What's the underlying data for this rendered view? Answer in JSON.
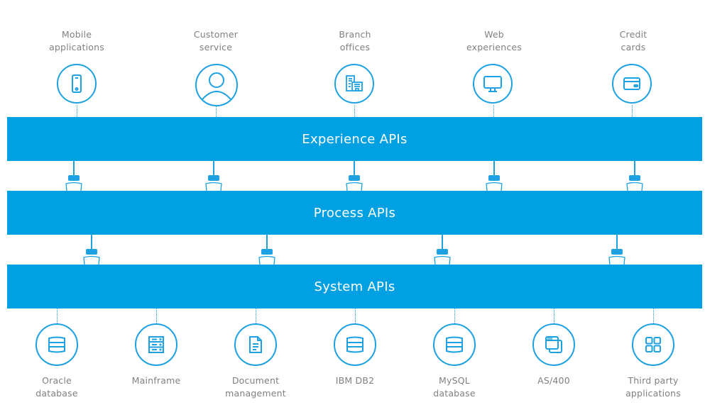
{
  "top_nodes": [
    {
      "label": "Mobile\napplications",
      "icon": "mobile-phone-icon"
    },
    {
      "label": "Customer\nservice",
      "icon": "user-icon"
    },
    {
      "label": "Branch\noffices",
      "icon": "building-icon"
    },
    {
      "label": "Web\nexperiences",
      "icon": "monitor-icon"
    },
    {
      "label": "Credit\ncards",
      "icon": "credit-card-icon"
    }
  ],
  "layers": {
    "experience": "Experience APIs",
    "process": "Process APIs",
    "system": "System APIs"
  },
  "bottom_nodes": [
    {
      "label": "Oracle\ndatabase",
      "icon": "database-icon"
    },
    {
      "label": "Mainframe",
      "icon": "server-icon"
    },
    {
      "label": "Document\nmanagement",
      "icon": "document-icon"
    },
    {
      "label": "IBM DB2",
      "icon": "database-icon"
    },
    {
      "label": "MySQL\ndatabase",
      "icon": "database-icon"
    },
    {
      "label": "AS/400",
      "icon": "windows-stack-icon"
    },
    {
      "label": "Third party\napplications",
      "icon": "app-grid-icon"
    }
  ],
  "colors": {
    "accent": "#00a0e3",
    "icon_stroke": "#1da1e2",
    "label": "#808080"
  }
}
